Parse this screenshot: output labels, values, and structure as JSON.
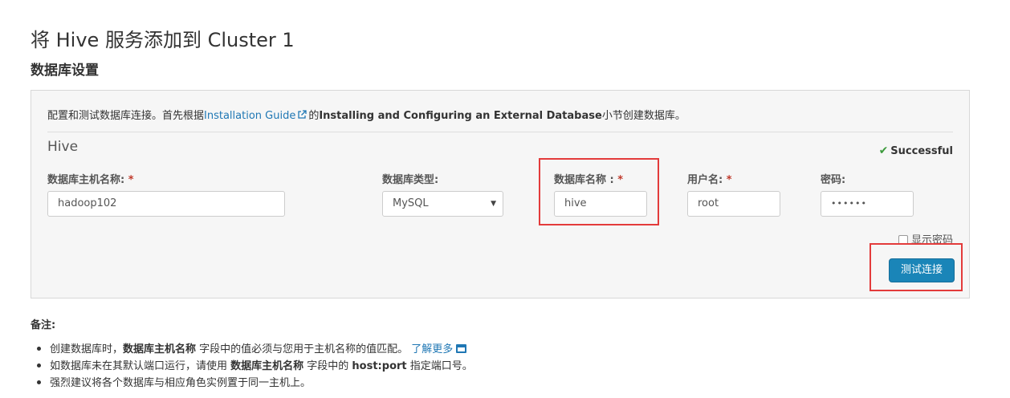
{
  "header": {
    "title": "将 Hive 服务添加到 Cluster 1",
    "section": "数据库设置"
  },
  "intro": {
    "prefix": "配置和测试数据库连接。首先根据",
    "link": "Installation Guide",
    "mid": "的",
    "bold": "Installing and Configuring an External Database",
    "suffix": "小节创建数据库。"
  },
  "service": {
    "name": "Hive",
    "status": "Successful",
    "status_color": "#3c9a3c"
  },
  "fields": {
    "host_label": "数据库主机名称:",
    "host_value": "hadoop102",
    "type_label": "数据库类型:",
    "type_value": "MySQL",
    "dbname_label": "数据库名称 :",
    "dbname_value": "hive",
    "user_label": "用户名:",
    "user_value": "root",
    "password_label": "密码:",
    "password_value": "••••••",
    "required_mark": "*"
  },
  "show_password_label": "显示密码",
  "test_button_label": "测试连接",
  "notes": {
    "title": "备注:",
    "items": [
      {
        "a": "创建数据库时，",
        "b": "数据库主机名称",
        "c": " 字段中的值必须与您用于主机名称的值匹配。 ",
        "link": "了解更多"
      },
      {
        "a": "如数据库未在其默认端口运行，请使用 ",
        "b": "数据库主机名称",
        "c": " 字段中的 ",
        "d": "host:port",
        "e": " 指定端口号。"
      },
      {
        "a": "强烈建议将各个数据库与相应角色实例置于同一主机上。"
      }
    ]
  },
  "colors": {
    "accent": "#1a85b8",
    "link": "#1f77b4",
    "highlight": "#e33b3b"
  }
}
